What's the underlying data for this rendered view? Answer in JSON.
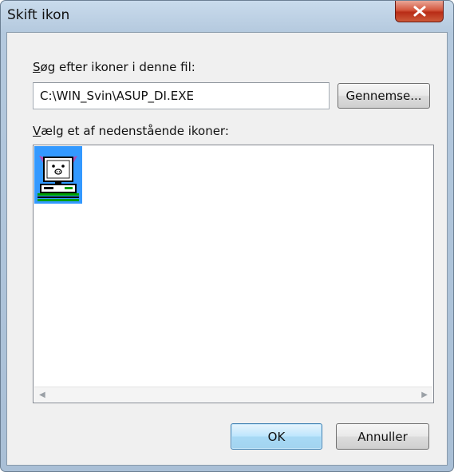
{
  "dialog": {
    "title": "Skift ikon",
    "close_icon": "close-icon"
  },
  "file_section": {
    "label_mnemonic": "S",
    "label_rest": "øg efter ikoner i denne fil:",
    "path_value": "C:\\WIN_Svin\\ASUP_DI.EXE",
    "browse_label": "Gennemse..."
  },
  "icon_section": {
    "label_mnemonic": "V",
    "label_rest": "ælg et af nedenstående ikoner:",
    "icons": [
      {
        "name": "computer-pig-icon",
        "selected": true
      }
    ],
    "scroll_left_icon": "scroll-left-arrow-icon",
    "scroll_right_icon": "scroll-right-arrow-icon"
  },
  "buttons": {
    "ok_label": "OK",
    "cancel_label": "Annuller"
  },
  "colors": {
    "selection": "#3399ff",
    "close_button": "#c8442a",
    "default_button": "#bee6fd"
  }
}
